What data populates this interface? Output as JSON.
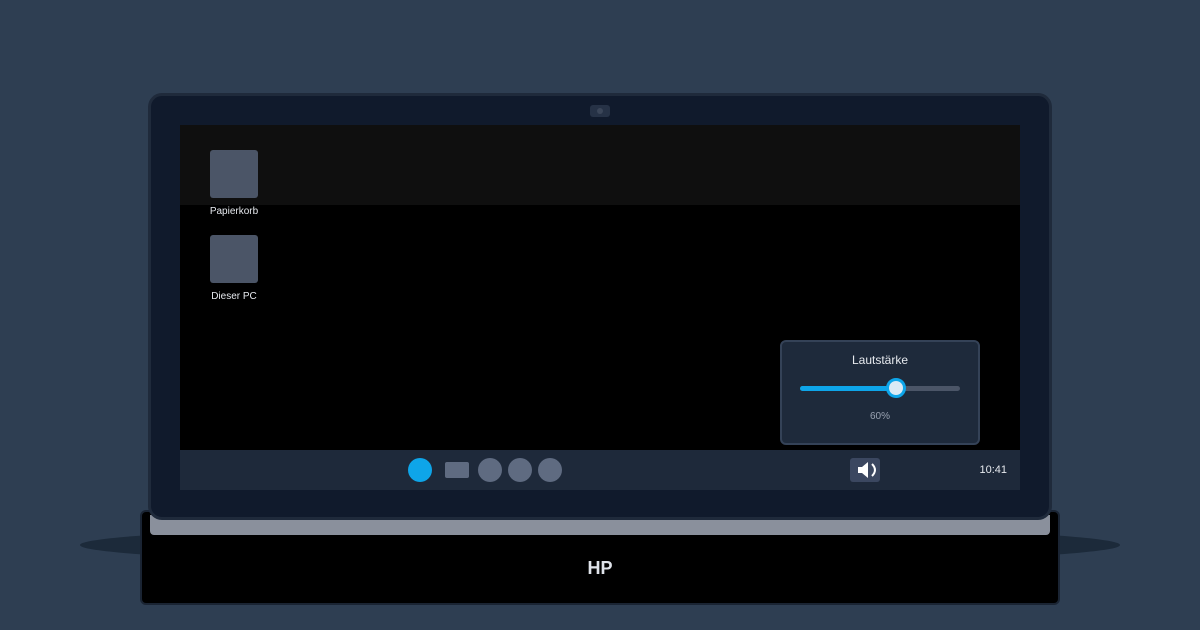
{
  "device": {
    "brand": "HP"
  },
  "desktop": {
    "icons": [
      {
        "label": "Papierkorb"
      },
      {
        "label": "Dieser PC"
      }
    ]
  },
  "volume_popup": {
    "title": "Lautstärke",
    "level_percent": 60,
    "value_text": "60%"
  },
  "taskbar": {
    "clock": "10:41",
    "items": [
      "start-icon",
      "folder-icon",
      "app-icon",
      "app-icon",
      "app-icon",
      "speaker-icon"
    ]
  },
  "colors": {
    "accent": "#0ea5e9",
    "taskbar": "#1e293a",
    "popup": "#1e2a3b"
  }
}
